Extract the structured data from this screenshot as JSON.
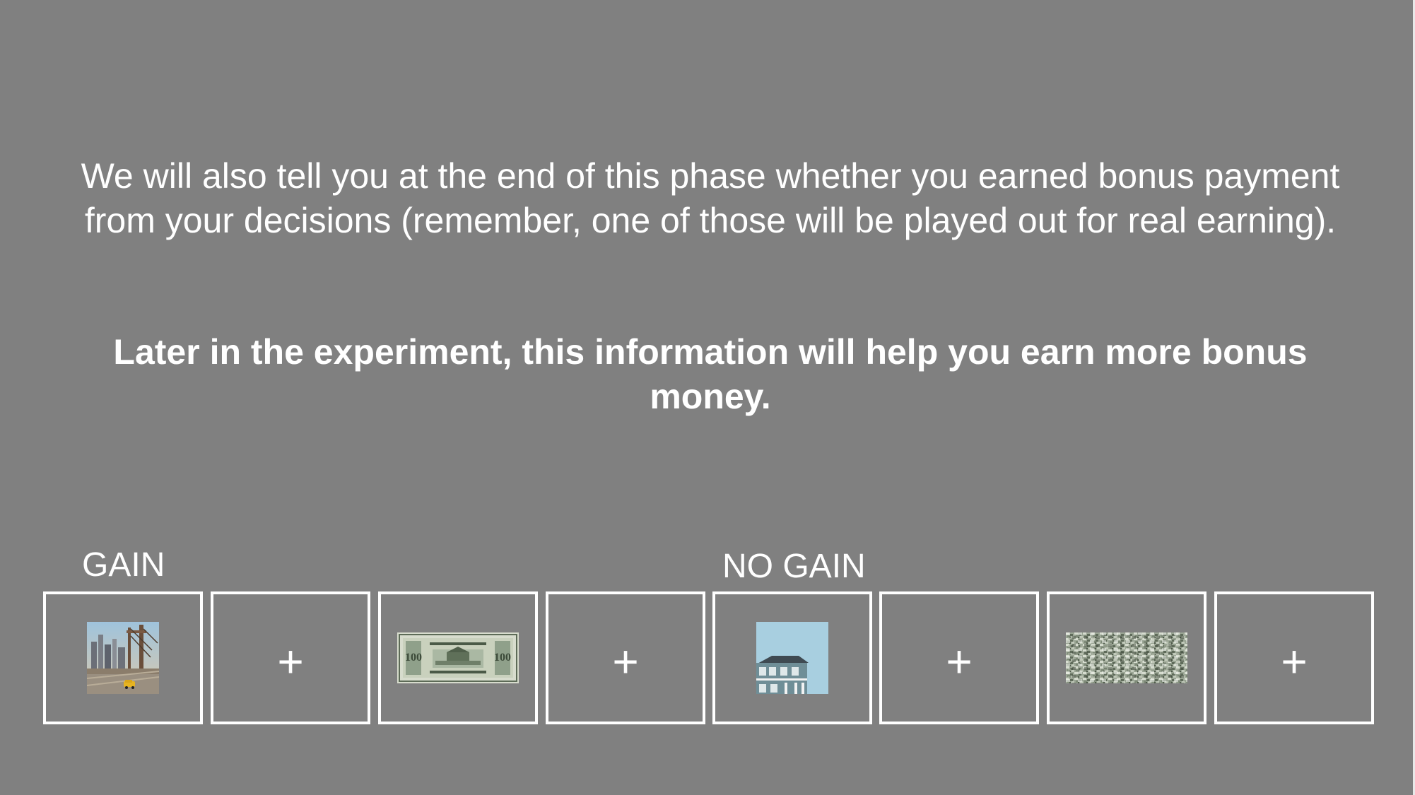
{
  "instructions": {
    "paragraph_1": "We will also tell you at the end of this phase whether you earned bonus payment from your decisions (remember, one of those will be played out for real earning).",
    "paragraph_2": "Later in the experiment, this information will help you earn more bonus money."
  },
  "labels": {
    "gain": "GAIN",
    "no_gain": "NO GAIN"
  },
  "sequence": [
    {
      "kind": "image",
      "icon": "city-bridge-photo"
    },
    {
      "kind": "fixation",
      "symbol": "+"
    },
    {
      "kind": "image",
      "icon": "hundred-dollar-bill-photo"
    },
    {
      "kind": "fixation",
      "symbol": "+"
    },
    {
      "kind": "image",
      "icon": "house-photo"
    },
    {
      "kind": "fixation",
      "symbol": "+"
    },
    {
      "kind": "image",
      "icon": "scrambled-noise-image"
    },
    {
      "kind": "fixation",
      "symbol": "+"
    }
  ],
  "colors": {
    "background": "#808080",
    "foreground": "#ffffff"
  }
}
